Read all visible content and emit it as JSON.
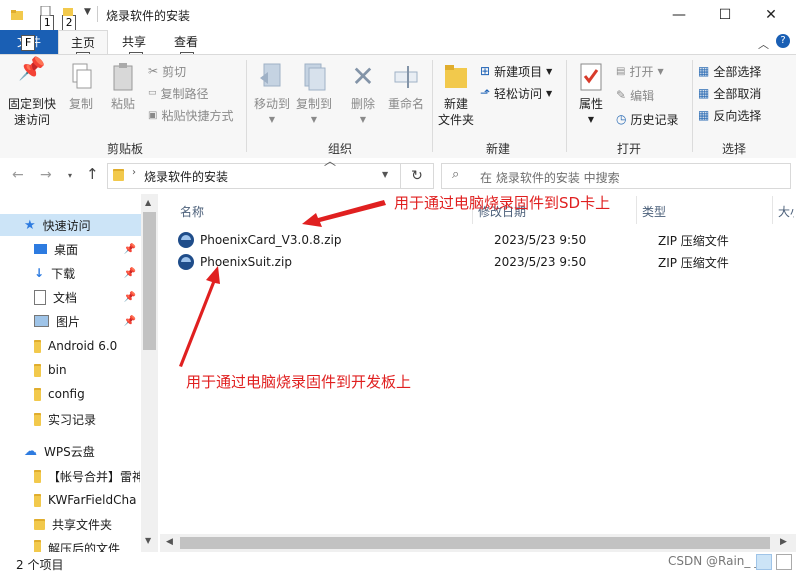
{
  "window": {
    "title": "烧录软件的安装"
  },
  "keytips": {
    "k1": "1",
    "k2": "2",
    "file": "F",
    "home": "H",
    "share": "S",
    "view": "V"
  },
  "tabs": {
    "file": "文件",
    "home": "主页",
    "share": "共享",
    "view": "查看"
  },
  "ribbon": {
    "clipboard": {
      "label": "剪贴板",
      "pin": "固定到快速访问",
      "pin_l1": "固定到快",
      "pin_l2": "速访问",
      "copy": "复制",
      "paste": "粘贴",
      "cut": "剪切",
      "copy_path": "复制路径",
      "paste_shortcut": "粘贴快捷方式"
    },
    "organize": {
      "label": "组织",
      "move_to": "移动到",
      "copy_to": "复制到",
      "delete": "删除",
      "rename": "重命名"
    },
    "new": {
      "label": "新建",
      "new_folder_l1": "新建",
      "new_folder_l2": "文件夹",
      "new_item": "新建项目",
      "easy_access": "轻松访问"
    },
    "open": {
      "label": "打开",
      "properties": "属性",
      "open": "打开",
      "edit": "编辑",
      "history": "历史记录"
    },
    "select": {
      "label": "选择",
      "select_all": "全部选择",
      "select_none": "全部取消",
      "invert": "反向选择"
    }
  },
  "address": {
    "path": "烧录软件的安装",
    "search_placeholder": "在 烧录软件的安装 中搜索"
  },
  "nav": {
    "quick_access": "快速访问",
    "items": [
      {
        "label": "桌面",
        "pinned": true
      },
      {
        "label": "下载",
        "pinned": true
      },
      {
        "label": "文档",
        "pinned": true
      },
      {
        "label": "图片",
        "pinned": true
      },
      {
        "label": "Android 6.0",
        "pinned": false
      },
      {
        "label": "bin",
        "pinned": false
      },
      {
        "label": "config",
        "pinned": false
      },
      {
        "label": "实习记录",
        "pinned": false
      }
    ],
    "wps": "WPS云盘",
    "wps_items": [
      "【帐号合并】雷神",
      "KWFarFieldCha",
      "共享文件夹",
      "解压后的文件"
    ]
  },
  "columns": {
    "name": "名称",
    "modified": "修改日期",
    "type": "类型",
    "size": "大小"
  },
  "files": [
    {
      "name": "PhoenixCard_V3.0.8.zip",
      "modified": "2023/5/23 9:50",
      "type": "ZIP 压缩文件"
    },
    {
      "name": "PhoenixSuit.zip",
      "modified": "2023/5/23 9:50",
      "type": "ZIP 压缩文件"
    }
  ],
  "annotations": {
    "a1": "用于通过电脑烧录固件到SD卡上",
    "a2": "用于通过电脑烧录固件到开发板上"
  },
  "status": {
    "count": "2 个项目"
  },
  "watermark": "CSDN @Rain_ _Li",
  "colors": {
    "accent": "#1a5fb4",
    "annotation": "#e02020",
    "selection": "#cce4f7"
  }
}
